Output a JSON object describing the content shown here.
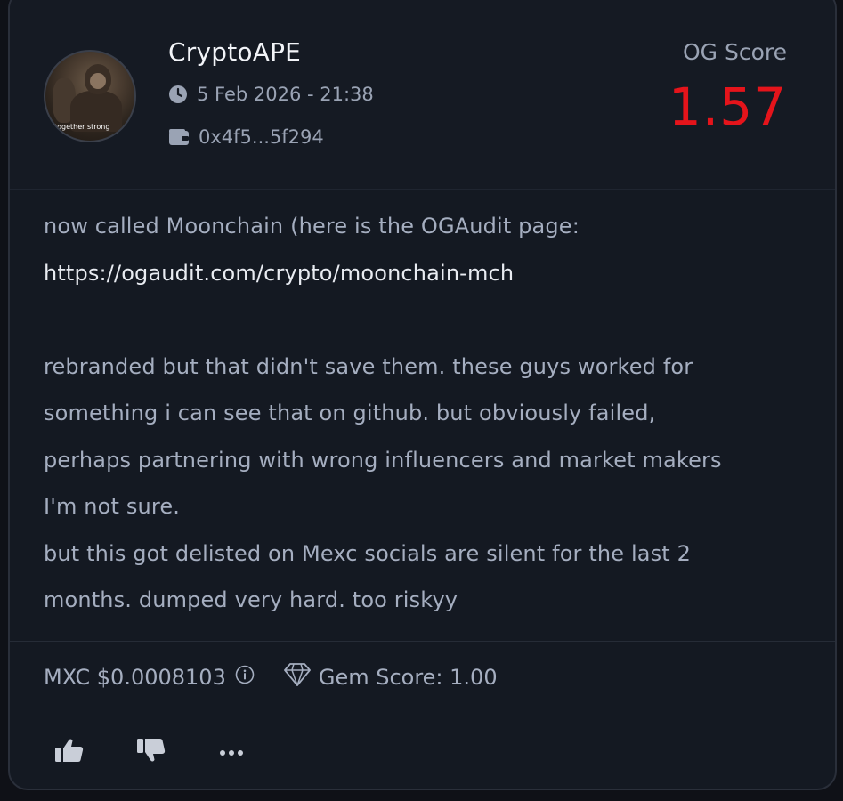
{
  "post": {
    "username": "CryptoAPE",
    "avatar_caption": "together strong",
    "date": "5 Feb 2026 - 21:38",
    "wallet": "0x4f5...5f294",
    "og_score_label": "OG Score",
    "og_score_value": "1.57",
    "body_lines": [
      "now called Moonchain (here is the OGAudit page:",
      "https://ogaudit.com/crypto/moonchain-mch",
      "",
      "rebranded but that didn't save them. these guys worked for",
      "something i can see that on github. but obviously failed,",
      "perhaps partnering with wrong influencers and market makers",
      "I'm not sure.",
      "but this got delisted on Mexc socials are silent for the last 2",
      "months. dumped very hard. too riskyy"
    ]
  },
  "footer": {
    "price": "MXC $0.0008103",
    "gem_score": "Gem Score: 1.00"
  },
  "icons": {
    "date": "clock-icon",
    "wallet": "wallet-icon",
    "price_info": "info-icon",
    "gem": "diamond-icon",
    "like": "thumbs-up-icon",
    "dislike": "thumbs-down-icon",
    "more": "more-icon"
  },
  "colors": {
    "background": "#0f1117",
    "card": "#141922",
    "score": "#e5141b",
    "text_muted": "#a5aec0",
    "text_bright": "#f2f4f8"
  }
}
